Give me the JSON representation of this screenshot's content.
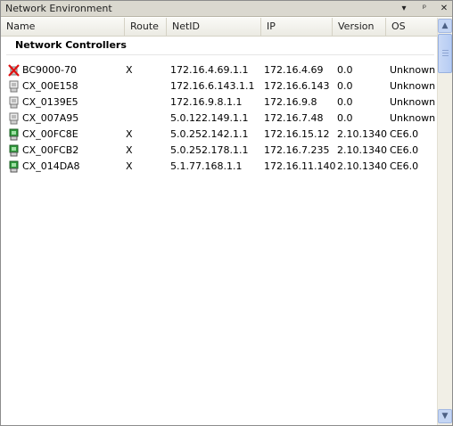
{
  "window": {
    "title": "Network Environment"
  },
  "titlebar_buttons": {
    "dropdown": "▾",
    "pin": "ᵖ",
    "close": "✕"
  },
  "columns": [
    "Name",
    "Route",
    "NetID",
    "IP",
    "Version",
    "OS"
  ],
  "group": {
    "label": "Network Controllers"
  },
  "rows": [
    {
      "icon": "error-device-icon",
      "name": "BC9000-70",
      "route": "X",
      "netid": "172.16.4.69.1.1",
      "ip": "172.16.4.69",
      "version": "0.0",
      "os": "Unknown"
    },
    {
      "icon": "device-gray-icon",
      "name": "CX_00E158",
      "route": "",
      "netid": "172.16.6.143.1.1",
      "ip": "172.16.6.143",
      "version": "0.0",
      "os": "Unknown"
    },
    {
      "icon": "device-gray-icon",
      "name": "CX_0139E5",
      "route": "",
      "netid": "172.16.9.8.1.1",
      "ip": "172.16.9.8",
      "version": "0.0",
      "os": "Unknown"
    },
    {
      "icon": "device-gray-icon",
      "name": "CX_007A95",
      "route": "",
      "netid": "5.0.122.149.1.1",
      "ip": "172.16.7.48",
      "version": "0.0",
      "os": "Unknown"
    },
    {
      "icon": "device-green-icon",
      "name": "CX_00FC8E",
      "route": "X",
      "netid": "5.0.252.142.1.1",
      "ip": "172.16.15.12",
      "version": "2.10.1340",
      "os": "CE6.0"
    },
    {
      "icon": "device-green-icon",
      "name": "CX_00FCB2",
      "route": "X",
      "netid": "5.0.252.178.1.1",
      "ip": "172.16.7.235",
      "version": "2.10.1340",
      "os": "CE6.0"
    },
    {
      "icon": "device-green-icon",
      "name": "CX_014DA8",
      "route": "X",
      "netid": "5.1.77.168.1.1",
      "ip": "172.16.11.140",
      "version": "2.10.1340",
      "os": "CE6.0"
    }
  ],
  "scrollbar": {
    "up": "▲",
    "down": "▼"
  }
}
